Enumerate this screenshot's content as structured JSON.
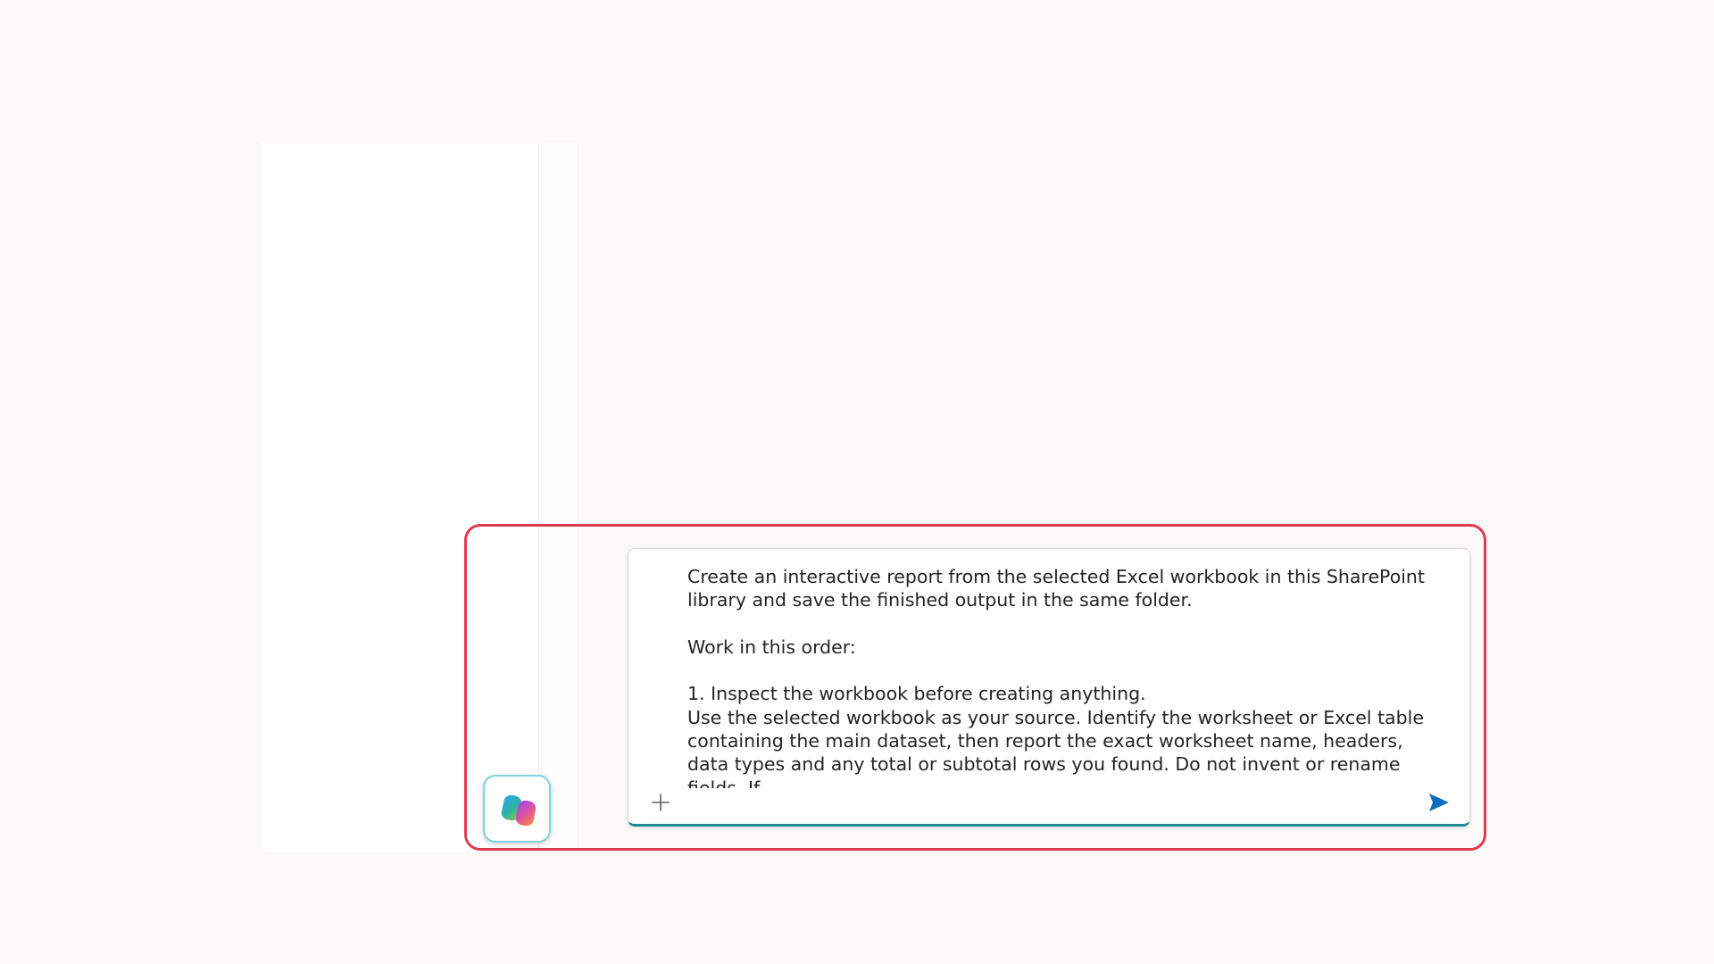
{
  "composer": {
    "prompt_text": "Create an interactive report from the selected Excel workbook in this SharePoint library and save the finished output in the same folder.\n\nWork in this order:\n\n1. Inspect the workbook before creating anything.\nUse the selected workbook as your source. Identify the worksheet or Excel table containing the main dataset, then report the exact worksheet name, headers, data types and any total or subtotal rows you found. Do not invent or rename fields. If",
    "attach_icon": "plus-icon",
    "send_icon": "send-icon"
  },
  "launcher": {
    "icon": "copilot-logo-icon"
  },
  "colors": {
    "highlight": "#e03a4f",
    "accent": "#1f8a96",
    "send": "#0f6cbd",
    "background": "#faf9f7"
  }
}
